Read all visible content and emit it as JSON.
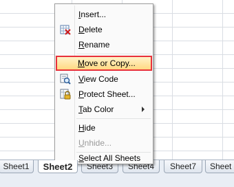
{
  "menu": {
    "items": [
      {
        "label": "Insert...",
        "enabled": true,
        "icon": ""
      },
      {
        "label": "Delete",
        "enabled": true,
        "icon": "delete-sheet-icon"
      },
      {
        "label": "Rename",
        "enabled": true,
        "icon": ""
      },
      {
        "label": "Move or Copy...",
        "enabled": true,
        "icon": "",
        "highlighted": true
      },
      {
        "label": "View Code",
        "enabled": true,
        "icon": "view-code-icon"
      },
      {
        "label": "Protect Sheet...",
        "enabled": true,
        "icon": "protect-sheet-icon"
      },
      {
        "label": "Tab Color",
        "enabled": true,
        "icon": "",
        "submenu": true
      },
      {
        "label": "Hide",
        "enabled": true,
        "icon": ""
      },
      {
        "label": "Unhide...",
        "enabled": false,
        "icon": ""
      },
      {
        "label": "Select All Sheets",
        "enabled": true,
        "icon": ""
      }
    ],
    "highlight_border_color": "#e8303a"
  },
  "sheet_tabs": [
    {
      "label": "Sheet1",
      "active": false
    },
    {
      "label": "Sheet2",
      "active": true
    },
    {
      "label": "Sheet3",
      "active": false
    },
    {
      "label": "Sheet4",
      "active": false
    },
    {
      "label": "Sheet7",
      "active": false
    },
    {
      "label": "Sheet",
      "active": false
    }
  ]
}
